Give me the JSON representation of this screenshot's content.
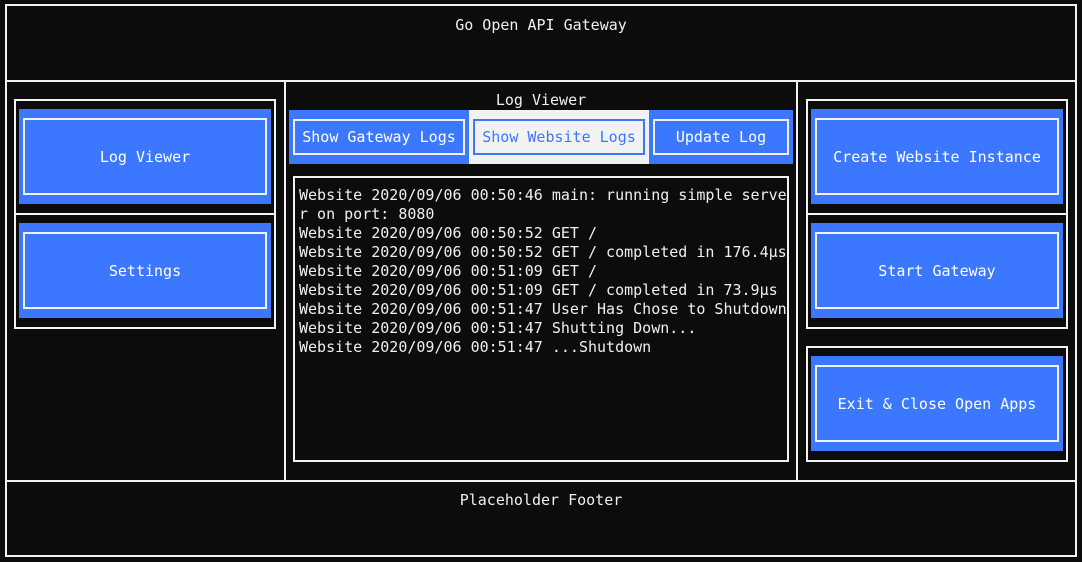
{
  "header": {
    "title": "Go Open API Gateway"
  },
  "left_nav": {
    "buttons": [
      {
        "label": "Log Viewer"
      },
      {
        "label": "Settings"
      }
    ]
  },
  "center": {
    "title": "Log Viewer",
    "tabs": [
      {
        "label": "Show Gateway Logs",
        "active": false
      },
      {
        "label": "Show Website Logs",
        "active": true
      },
      {
        "label": "Update Log",
        "active": false
      }
    ],
    "log_lines": [
      "Website 2020/09/06 00:50:46 main: running simple server on port: 8080",
      "Website 2020/09/06 00:50:52 GET /",
      "Website 2020/09/06 00:50:52 GET / completed in 176.4µs",
      "Website 2020/09/06 00:51:09 GET /",
      "Website 2020/09/06 00:51:09 GET / completed in 73.9µs",
      "Website 2020/09/06 00:51:47 User Has Chose to Shutdown",
      "Website 2020/09/06 00:51:47 Shutting Down...",
      "Website 2020/09/06 00:51:47 ...Shutdown"
    ]
  },
  "right_actions": {
    "buttons": [
      {
        "label": "Create Website Instance"
      },
      {
        "label": "Start Gateway"
      },
      {
        "label": "Exit & Close Open Apps"
      }
    ]
  },
  "footer": {
    "text": "Placeholder Footer"
  },
  "colors": {
    "accent": "#3b78ff",
    "background": "#0c0c0c",
    "border": "#f2f2f2"
  }
}
